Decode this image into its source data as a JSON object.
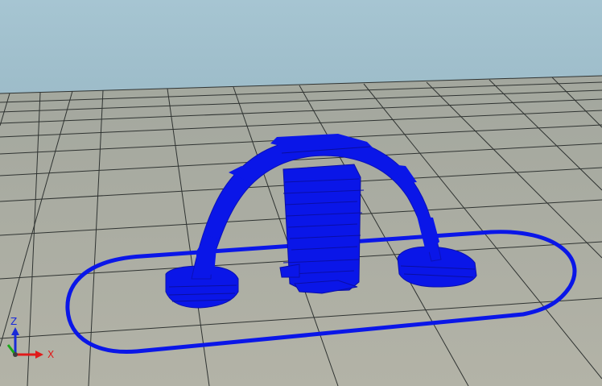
{
  "viewport": {
    "sky_color": "#a3c2cf",
    "floor_color": "#a9ab9f",
    "grid_color": "#2e3230",
    "model_color": "#0a16e8",
    "model_edge_color": "#0a12b8"
  },
  "axis_triad": {
    "z_label": "Z",
    "x_label": "X",
    "z_color": "#1a2ad8",
    "x_color": "#e01a1a",
    "y_color": "#18a818"
  }
}
